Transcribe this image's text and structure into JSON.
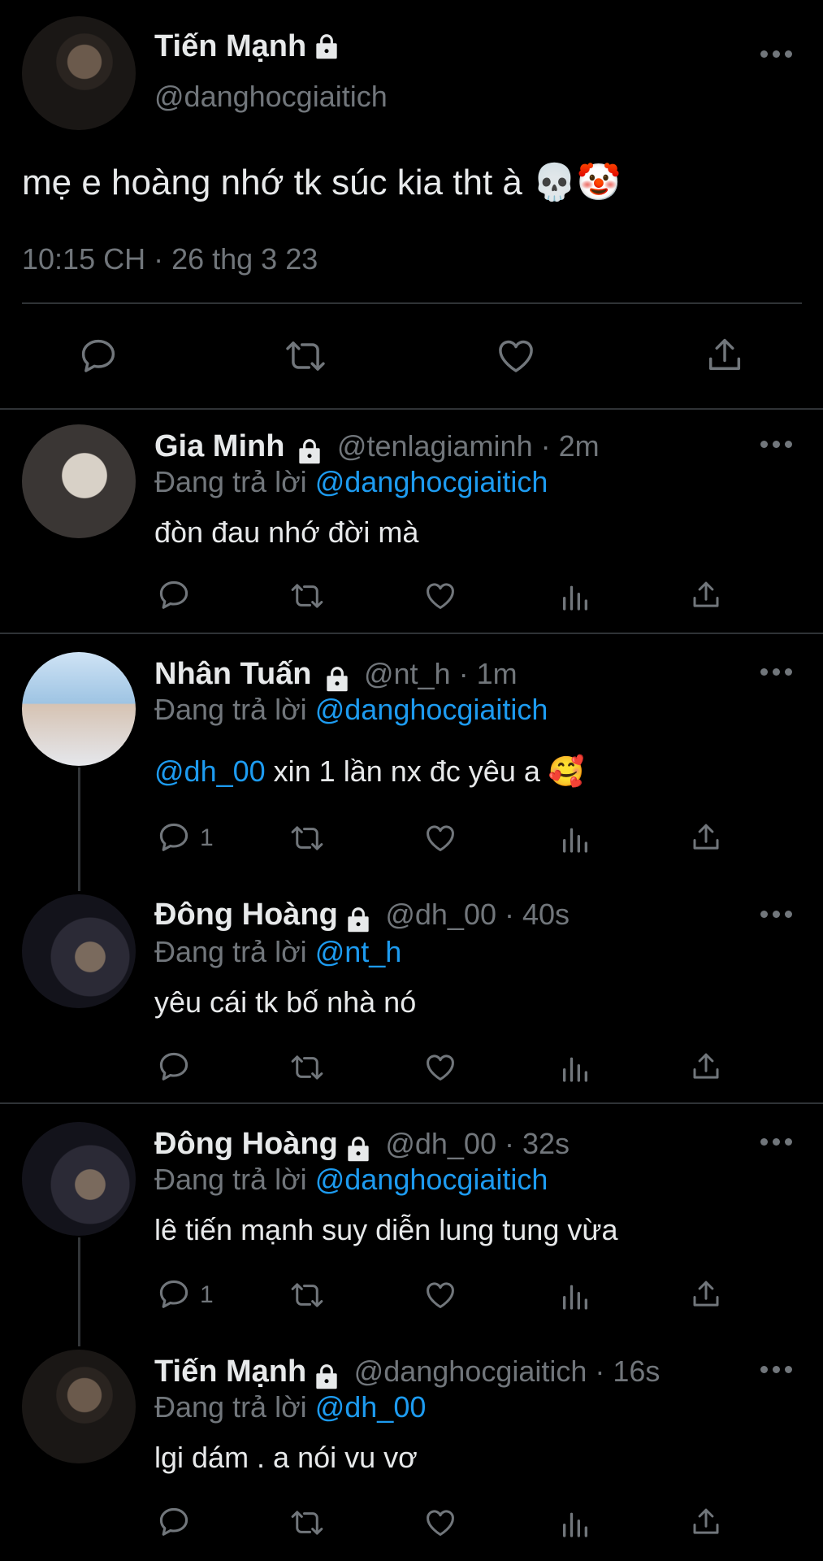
{
  "main_tweet": {
    "name": "Tiến Mạnh",
    "handle": "@danghocgiaitich",
    "text": "mẹ e hoàng nhớ tk súc kia tht à 💀🤡",
    "timestamp": "10:15 CH · 26 thg 3 23"
  },
  "replies": [
    {
      "name": "Gia Minh",
      "handle_time": "@tenlagiaminh · 2m",
      "reply_prefix": "Đang trả lời",
      "reply_to": "@danghocgiaitich",
      "text": "đòn đau nhớ đời mà",
      "reply_count": ""
    },
    {
      "name": "Nhân Tuấn",
      "handle_time": "@nt_h · 1m",
      "reply_prefix": "Đang trả lời",
      "reply_to": "@danghocgiaitich",
      "mention": "@dh_00",
      "text": " xin 1 lần nx đc yêu a 🥰",
      "reply_count": "1"
    },
    {
      "name": "Đông Hoàng",
      "handle_time": "@dh_00 · 40s",
      "reply_prefix": "Đang trả lời",
      "reply_to": "@nt_h",
      "text": "yêu cái tk bố nhà nó",
      "reply_count": ""
    },
    {
      "name": "Đông Hoàng",
      "handle_time": "@dh_00 · 32s",
      "reply_prefix": "Đang trả lời",
      "reply_to": "@danghocgiaitich",
      "text": "lê tiến mạnh suy diễn lung tung vừa",
      "reply_count": "1"
    },
    {
      "name": "Tiến Mạnh",
      "handle_time": "@danghocgiaitich · 16s",
      "reply_prefix": "Đang trả lời",
      "reply_to": "@dh_00",
      "text": "lgi dám . a nói vu vơ",
      "reply_count": ""
    }
  ],
  "icons": {
    "reply": "reply-icon",
    "retweet": "retweet-icon",
    "like": "heart-icon",
    "views": "views-icon",
    "share": "share-icon",
    "lock": "lock-icon",
    "more": "more-icon"
  },
  "colors": {
    "background": "#000000",
    "text": "#e7e9ea",
    "muted": "#71767b",
    "link": "#1d9bf0",
    "divider": "#2f3336"
  }
}
